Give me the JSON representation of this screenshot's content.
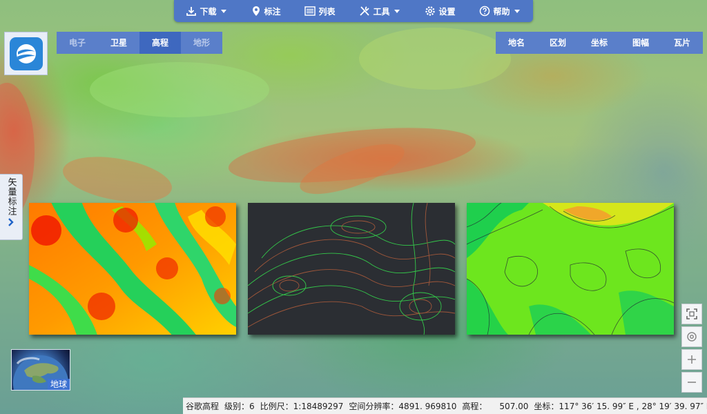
{
  "toolbar": {
    "download": "下载",
    "mark": "标注",
    "list": "列表",
    "tools": "工具",
    "settings": "设置",
    "help": "帮助"
  },
  "map_tabs": {
    "electronic": "电子",
    "satellite": "卫星",
    "elevation": "高程",
    "terrain": "地形"
  },
  "right_tabs": {
    "placename": "地名",
    "district": "区划",
    "coordinate": "坐标",
    "mapsheet": "图幅",
    "tile": "瓦片"
  },
  "side_tab": {
    "label": "矢量标注"
  },
  "globe": {
    "label": "地球"
  },
  "status": {
    "source": "谷歌高程",
    "level": "级别：6",
    "scale": "比例尺：1:18489297",
    "resolution": "空间分辨率：4891. 969810",
    "elevation_label": "高程：",
    "elevation_value": "507.00",
    "coordinate": "坐标：117° 36′ 15. 99″ E , 28° 19′ 39. 97″ N"
  },
  "colors": {
    "toolbar": "#4f77c6",
    "tab_active": "#3e68bf",
    "tab_bg": "#5a7fca"
  },
  "icons": {
    "download": "download-icon",
    "mark": "map-pin-icon",
    "list": "list-icon",
    "tools": "tools-icon",
    "settings": "gear-icon",
    "help": "help-circle-icon",
    "fullscreen": "fullscreen-icon",
    "locate": "locate-icon",
    "zoom_in": "plus-icon",
    "zoom_out": "minus-icon",
    "expand": "chevron-right-icon"
  }
}
